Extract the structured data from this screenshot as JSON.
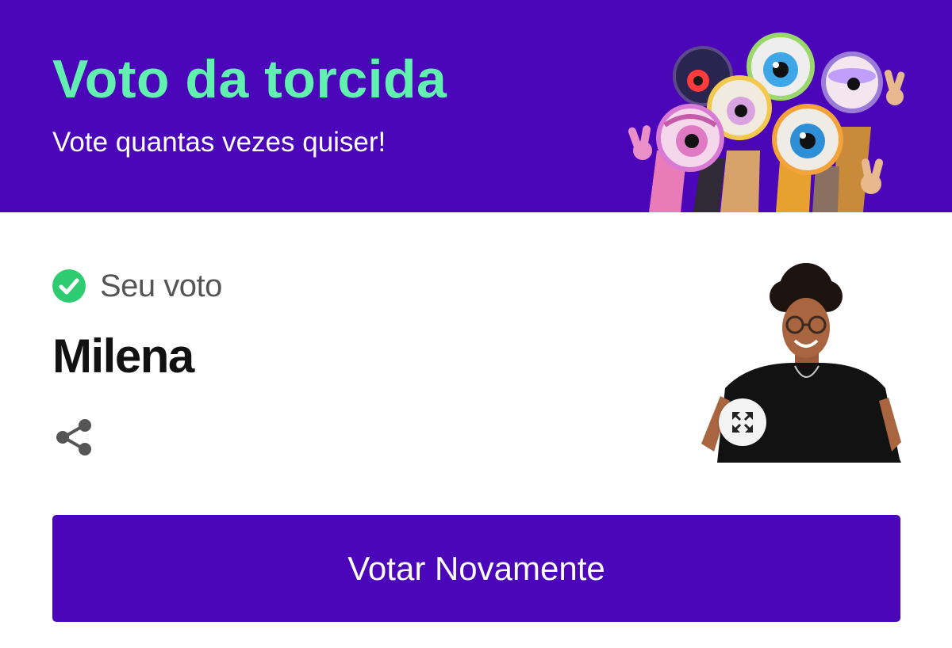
{
  "header": {
    "title": "Voto da torcida",
    "subtitle": "Vote quantas vezes quiser!",
    "background_color": "#4a06b8",
    "title_color": "#62f0b0",
    "illustration": "big-brother-eye-mascots"
  },
  "vote": {
    "status_label": "Seu voto",
    "status_icon": "check-circle-icon",
    "status_color": "#2ecc71",
    "candidate_name": "Milena",
    "share_icon": "share-icon",
    "photo": "candidate-photo",
    "expand_icon": "expand-icon"
  },
  "actions": {
    "vote_again_label": "Votar Novamente",
    "button_color": "#4a06b8"
  }
}
